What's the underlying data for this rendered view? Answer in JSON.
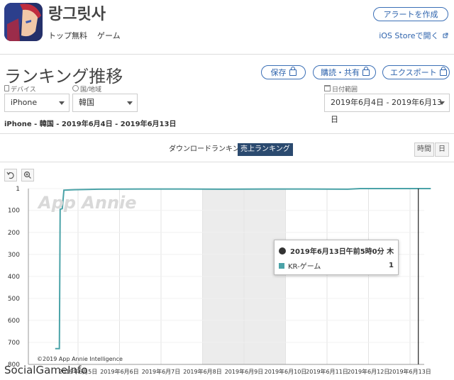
{
  "app": {
    "name": "랑그릿사",
    "tags": [
      "トップ無料",
      "ゲーム"
    ]
  },
  "header": {
    "alert_button": "アラートを作成",
    "ios_link": "iOS Storeで開く"
  },
  "page": {
    "title": "ランキング推移"
  },
  "actions": [
    {
      "label": "保存"
    },
    {
      "label": "購読・共有"
    },
    {
      "label": "エクスポート"
    }
  ],
  "filters": {
    "device_label": "デバイス",
    "device_value": "iPhone",
    "country_label": "国/地域",
    "country_value": "韓国",
    "date_label": "日付範囲",
    "date_value": "2019年6月4日 - 2019年6月13日"
  },
  "summary": "iPhone - 韓国 - 2019年6月4日 - 2019年6月13日",
  "tabs": [
    {
      "label": "ダウンロードランキング",
      "active": false
    },
    {
      "label": "売上ランキング",
      "active": true
    }
  ],
  "granularity": [
    "時間",
    "日"
  ],
  "chart_data": {
    "type": "line",
    "y_ticks": [
      "1",
      "100",
      "200",
      "300",
      "400",
      "500",
      "600",
      "700",
      "800"
    ],
    "y_inverted": true,
    "ylim": [
      1,
      800
    ],
    "x_ticks": [
      "2019年6月5日",
      "2019年6月6日",
      "2019年6月7日",
      "2019年6月8日",
      "2019年6月9日",
      "2019年6月10日",
      "2019年6月11日",
      "2019年6月12日",
      "2019年6月13日"
    ],
    "weekend_shaded": [
      "2019年6月8日",
      "2019年6月9日"
    ],
    "series": [
      {
        "name": "KR-ゲーム",
        "color": "#4ba3a8",
        "points": [
          {
            "t": 0.45,
            "rank": 728
          },
          {
            "t": 0.55,
            "rank": 728
          },
          {
            "t": 0.57,
            "rank": 95
          },
          {
            "t": 0.62,
            "rank": 92
          },
          {
            "t": 0.66,
            "rank": 8
          },
          {
            "t": 0.9,
            "rank": 6
          },
          {
            "t": 1.5,
            "rank": 4
          },
          {
            "t": 2.5,
            "rank": 3
          },
          {
            "t": 3.5,
            "rank": 3
          },
          {
            "t": 4.5,
            "rank": 4
          },
          {
            "t": 5.5,
            "rank": 3
          },
          {
            "t": 6.5,
            "rank": 3
          },
          {
            "t": 7.5,
            "rank": 4
          },
          {
            "t": 7.8,
            "rank": 1
          },
          {
            "t": 9.5,
            "rank": 1
          }
        ]
      }
    ],
    "tooltip": {
      "title": "2019年6月13日午前5時0分 木",
      "series": "KR-ゲーム",
      "value": "1"
    },
    "watermark": "App Annie",
    "copyright": "©2019 App Annie Intelligence"
  },
  "footer_logo": "SocialGameInfo"
}
